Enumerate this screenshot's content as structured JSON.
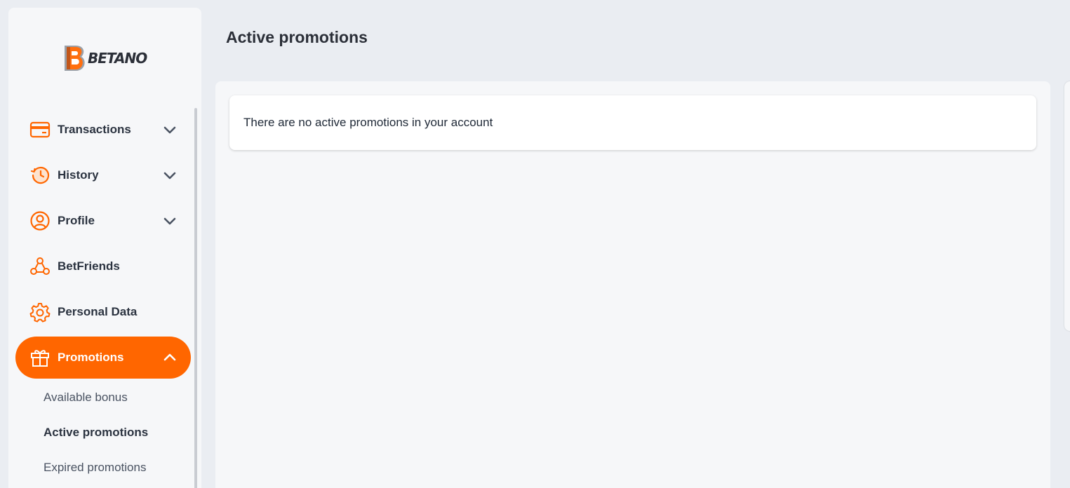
{
  "brand": {
    "name": "BETANO",
    "accent": "#ff6600"
  },
  "sidebar": {
    "items": [
      {
        "label": "Transactions",
        "icon": "credit-card-icon",
        "expandable": true
      },
      {
        "label": "History",
        "icon": "history-icon",
        "expandable": true
      },
      {
        "label": "Profile",
        "icon": "user-icon",
        "expandable": true
      },
      {
        "label": "BetFriends",
        "icon": "network-icon",
        "expandable": false
      },
      {
        "label": "Personal Data",
        "icon": "gear-icon",
        "expandable": false
      },
      {
        "label": "Promotions",
        "icon": "gift-icon",
        "expandable": true,
        "active": true
      }
    ],
    "subitems": [
      {
        "label": "Available bonus"
      },
      {
        "label": "Active promotions",
        "current": true
      },
      {
        "label": "Expired promotions"
      }
    ]
  },
  "main": {
    "title": "Active promotions",
    "empty_message": "There are no active promotions in your account"
  }
}
